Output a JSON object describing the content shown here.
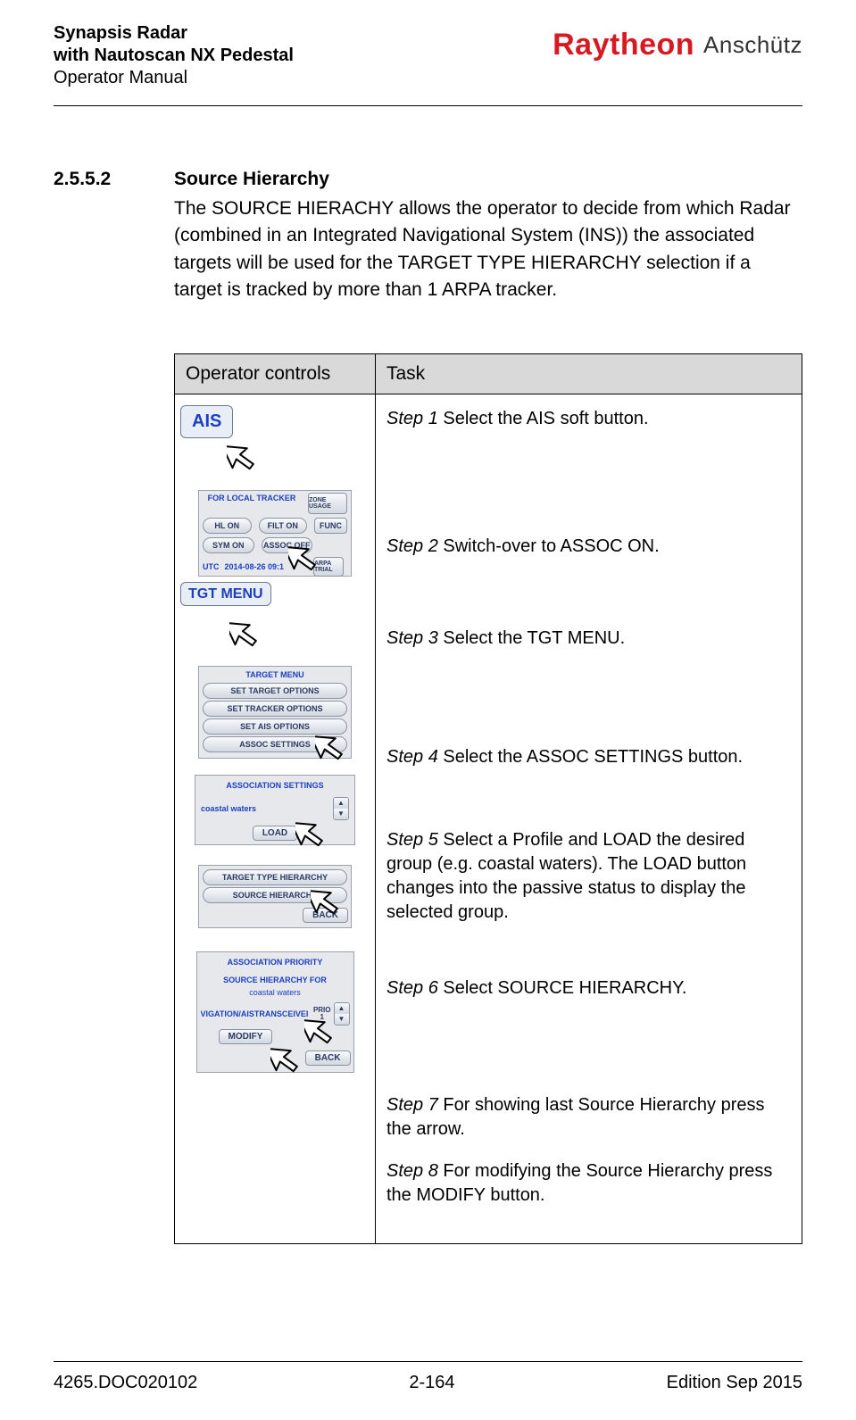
{
  "header": {
    "title_line1": "Synapsis Radar",
    "title_line2": "with Nautoscan NX Pedestal",
    "subtitle": "Operator Manual",
    "brand_primary": "Raytheon",
    "brand_secondary": "Anschütz"
  },
  "section": {
    "number": "2.5.5.2",
    "title": "Source Hierarchy",
    "body": "The SOURCE HIERACHY allows the operator to decide from which Radar (combined in an Integrated Navigational System (INS)) the associated targets will be used for the TARGET TYPE HIERARCHY selection if a target is tracked by more than 1 ARPA tracker."
  },
  "table": {
    "head_controls": "Operator controls",
    "head_task": "Task",
    "steps": {
      "s1_label": "Step 1",
      "s1_text": " Select the AIS soft button.",
      "s2_label": "Step 2",
      "s2_text": " Switch-over to ASSOC ON.",
      "s3_label": "Step 3",
      "s3_text": " Select the TGT MENU.",
      "s4_label": "Step 4",
      "s4_text": " Select the ASSOC SETTINGS button.",
      "s5_label": "Step 5",
      "s5_text": " Select a Profile and LOAD the desired group (e.g. coastal waters). The LOAD button changes into the passive status to display the selected group.",
      "s6_label": "Step 6",
      "s6_text": " Select SOURCE HIERARCHY.",
      "s7_label": "Step 7",
      "s7_text": " For showing last Source Hierarchy press the arrow.",
      "s8_label": "Step 8",
      "s8_text": " For modifying the Source Hierarchy press the MODIFY button."
    }
  },
  "ui": {
    "ais": "AIS",
    "tracker_header": "FOR LOCAL TRACKER",
    "zone_usage": "ZONE USAGE",
    "hl_on": "HL ON",
    "filt_on": "FILT ON",
    "sym_on": "SYM ON",
    "assoc_off": "ASSOC OFF",
    "func": "FUNC",
    "utc": "UTC",
    "date": "2014-08-26  09:1",
    "arpa_trial": "ARPA TRIAL",
    "tgt_menu": "TGT MENU",
    "target_menu": "TARGET MENU",
    "set_target_options": "SET TARGET OPTIONS",
    "set_tracker_options": "SET TRACKER OPTIONS",
    "set_ais_options": "SET AIS OPTIONS",
    "assoc_settings": "ASSOC SETTINGS",
    "association_settings": "ASSOCIATION SETTINGS",
    "coastal_waters": "coastal waters",
    "load": "LOAD",
    "target_type_hierarchy": "TARGET TYPE HIERARCHY",
    "source_hierarchy": "SOURCE HIERARCHY",
    "back": "BACK",
    "association_priority": "ASSOCIATION PRIORITY",
    "source_hierarchy_for": "SOURCE HIERARCHY FOR",
    "vigation": "VIGATION/AISTRANSCEIVEI",
    "prio": "PRIO",
    "prio_num": "1",
    "modify": "MODIFY"
  },
  "footer": {
    "doc": "4265.DOC020102",
    "page": "2-164",
    "edition": "Edition Sep 2015"
  }
}
